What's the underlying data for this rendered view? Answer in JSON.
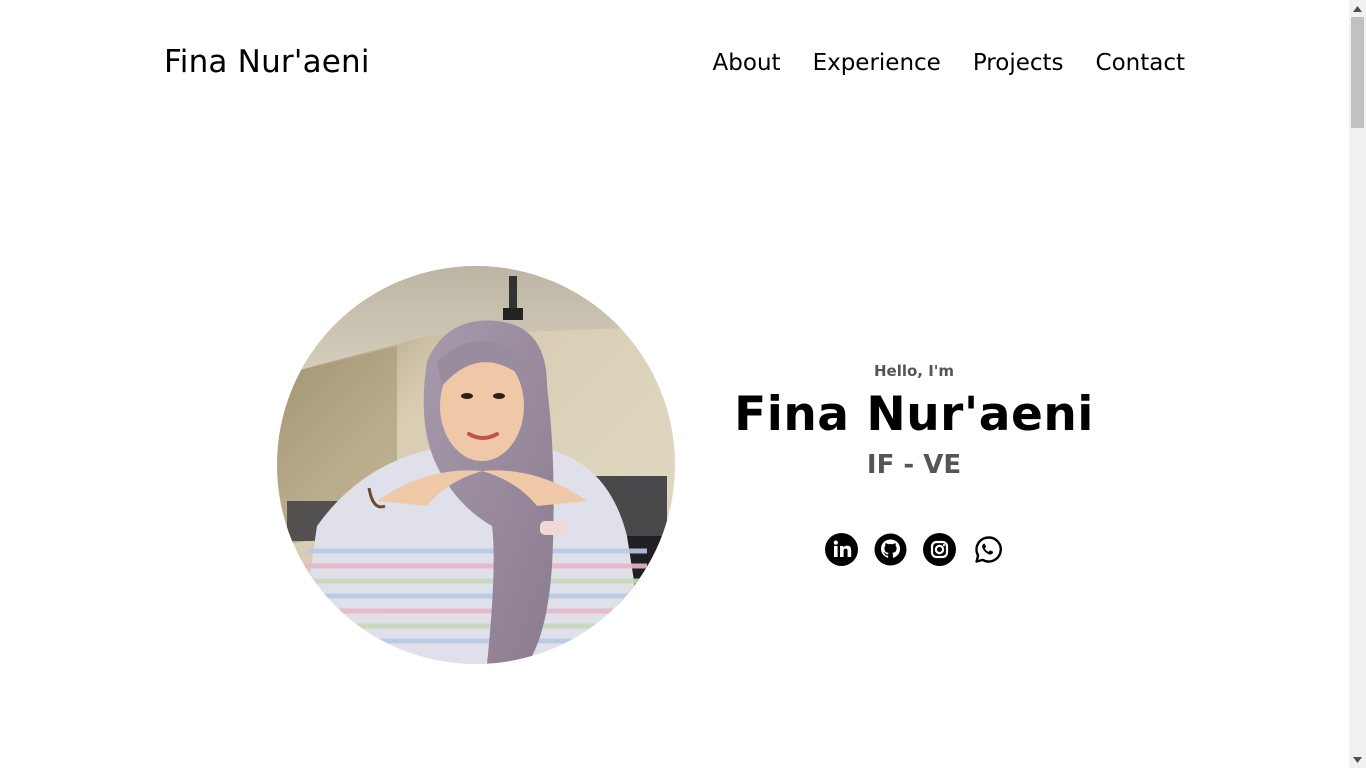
{
  "header": {
    "logo": "Fina Nur'aeni",
    "nav": [
      {
        "label": "About"
      },
      {
        "label": "Experience"
      },
      {
        "label": "Projects"
      },
      {
        "label": "Contact"
      }
    ]
  },
  "hero": {
    "greeting": "Hello, I'm",
    "name": "Fina Nur'aeni",
    "subtitle": "IF - VE",
    "photo_icon": "profile-photo",
    "socials": [
      {
        "icon": "linkedin-icon"
      },
      {
        "icon": "github-icon"
      },
      {
        "icon": "instagram-icon"
      },
      {
        "icon": "whatsapp-icon"
      }
    ]
  },
  "colors": {
    "text": "#000000",
    "muted": "#555555",
    "background": "#ffffff"
  }
}
